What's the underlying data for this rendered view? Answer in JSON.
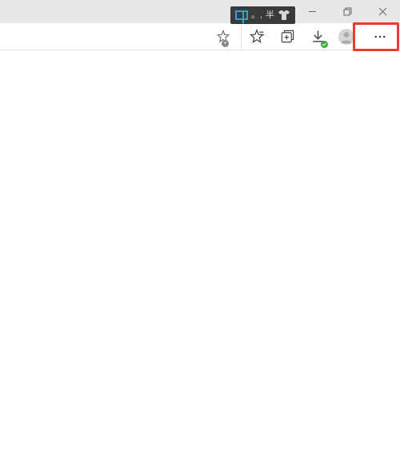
{
  "ime": {
    "mode": "中",
    "punct": "。,",
    "width": "半",
    "shirt": "shirt"
  },
  "window": {
    "minimize": "minimize",
    "maximize": "maximize",
    "close": "close"
  },
  "toolbar": {
    "star_add": "add-favorite",
    "favorites": "favorites",
    "collections": "collections",
    "downloads": "downloads",
    "profile": "profile",
    "more": "more"
  }
}
